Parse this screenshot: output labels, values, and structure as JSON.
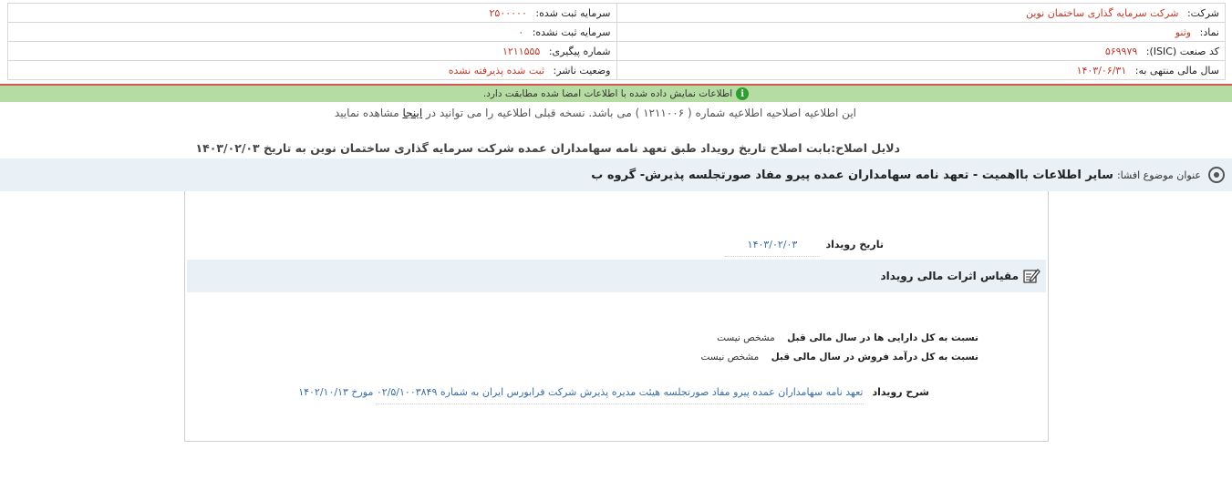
{
  "company_info": {
    "company_label": "شرکت:",
    "company_value": "شرکت سرمایه گذاری ساختمان نوین",
    "registered_capital_label": "سرمایه ثبت شده:",
    "registered_capital_value": "۲۵۰۰۰۰۰",
    "symbol_label": "نماد:",
    "symbol_value": "وثنو",
    "unregistered_capital_label": "سرمایه ثبت نشده:",
    "unregistered_capital_value": "۰",
    "isic_label": "کد صنعت (ISIC):",
    "isic_value": "۵۶۹۹۷۹",
    "tracking_label": "شماره پیگیری:",
    "tracking_value": "۱۲۱۱۵۵۵",
    "fiscal_year_label": "سال مالی منتهی به:",
    "fiscal_year_value": "۱۴۰۳/۰۶/۳۱",
    "publisher_status_label": "وضعیت ناشر:",
    "publisher_status_value": "ثبت شده پذیرفته نشده"
  },
  "notice": {
    "icon": "info-icon",
    "text": "اطلاعات نمایش داده شده با اطلاعات امضا شده مطابقت دارد."
  },
  "correction": {
    "text_before": "این اطلاعیه اصلاحیه اطلاعیه شماره ( ۱۲۱۱۰۰۶ ) می باشد. نسخه قبلی اطلاعیه را می توانید در",
    "link": "اینجا",
    "text_after": "مشاهده نمایید"
  },
  "reason": "دلایل اصلاح:بابت اصلاح تاریخ رویداد طبق تعهد نامه سهامداران عمده شرکت سرمایه گذاری ساختمان نوین به تاریخ ۱۴۰۳/۰۲/۰۳",
  "subject": {
    "label": "عنوان موضوع افشا:",
    "title": "سایر اطلاعات بااهمیت - تعهد نامه سهامداران عمده پیرو مفاد صورتجلسه پذیرش- گروه ب"
  },
  "event": {
    "date_label": "تاریخ رویداد",
    "date_value": "۱۴۰۳/۰۲/۰۳",
    "section_title": "مقیاس اثرات مالی رویداد",
    "assets_ratio_label": "نسبت به کل دارایی ها در سال مالی قبل",
    "assets_ratio_value": "مشخص نیست",
    "revenue_ratio_label": "نسبت به کل درآمد فروش در سال مالی قبل",
    "revenue_ratio_value": "مشخص نیست",
    "description_label": "شرح رویداد",
    "description_value": "تعهد نامه سهامداران عمده پیرو مفاد صورتجلسه هیئت مدیره پذیرش شرکت فرابورس ایران به شماره ۰۲/۵/۱۰۰۳۸۴۹ مورخ ۱۴۰۲/۱۰/۱۳"
  },
  "colors": {
    "value_red": "#c0392b",
    "notice_green": "#b5dca2",
    "section_blue": "#e9f0f6",
    "link_blue": "#3a6ea5"
  }
}
